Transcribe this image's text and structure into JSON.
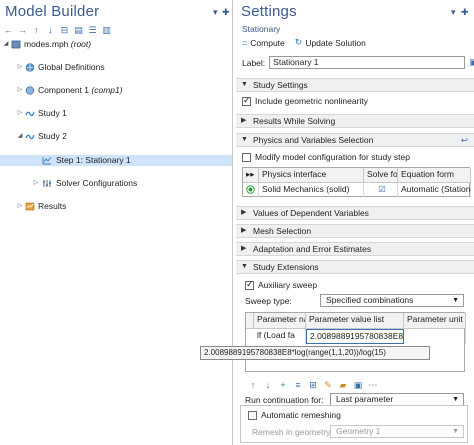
{
  "model_builder": {
    "title": "Model Builder",
    "pin_icon": "pin-icon",
    "toolbar": [
      "back-arrow-icon",
      "forward-arrow-icon",
      "up-arrow-icon",
      "down-arrow-icon",
      "collapse-icon",
      "expand-icon",
      "view-options-icon",
      "more-icon"
    ],
    "tree": [
      {
        "label": "modes.mph",
        "suffix": "(root)",
        "icon": "model-file-icon",
        "level": 0,
        "expanded": true
      },
      {
        "label": "Global Definitions",
        "suffix": "",
        "icon": "globe-icon",
        "level": 1,
        "expanded": false
      },
      {
        "label": "Component 1",
        "suffix": "(comp1)",
        "icon": "component-icon",
        "level": 1,
        "expanded": false
      },
      {
        "label": "Study 1",
        "suffix": "",
        "icon": "study-icon",
        "level": 1,
        "expanded": false
      },
      {
        "label": "Study 2",
        "suffix": "",
        "icon": "study-icon",
        "level": 1,
        "expanded": true
      },
      {
        "label": "Step 1: Stationary 1",
        "suffix": "",
        "icon": "stationary-step-icon",
        "level": 2,
        "selected": true
      },
      {
        "label": "Solver Configurations",
        "suffix": "",
        "icon": "solver-icon",
        "level": 2,
        "expanded": false
      },
      {
        "label": "Results",
        "suffix": "",
        "icon": "results-icon",
        "level": 1,
        "expanded": false
      }
    ]
  },
  "settings": {
    "title": "Settings",
    "subtitle": "Stationary",
    "compute_label": "Compute",
    "update_label": "Update Solution",
    "label_caption": "Label:",
    "label_value": "Stationary 1",
    "sections": {
      "study_settings": "Study Settings",
      "include_geom": "Include geometric nonlinearity",
      "results_while_solving": "Results While Solving",
      "physics_selection": "Physics and Variables Selection",
      "modify_config": "Modify model configuration for study step",
      "values_dependent": "Values of Dependent Variables",
      "mesh_selection": "Mesh Selection",
      "adaptation": "Adaptation and Error Estimates",
      "study_extensions": "Study Extensions"
    },
    "physics_table": {
      "headers": [
        "Physics interface",
        "Solve for",
        "Equation form"
      ],
      "rows": [
        {
          "interface": "Solid Mechanics (solid)",
          "solve_for": true,
          "equation_form": "Automatic (Station..."
        }
      ]
    },
    "aux_sweep": {
      "label": "Auxiliary sweep",
      "checked": true,
      "sweep_type_label": "Sweep type:",
      "sweep_type_value": "Specified combinations",
      "table_headers": [
        "Parameter na",
        "Parameter value list",
        "Parameter unit"
      ],
      "table_row": {
        "name": "lf (Load fa",
        "value": "2.0089889195780838E8*lo...",
        "unit": ""
      },
      "tooltip": "2.0089889195780838E8*log(range(1,1,20))/log(15)",
      "run_continuation_label": "Run continuation for:",
      "run_continuation_value": "Last parameter",
      "auto_remesh_label": "Automatic remeshing",
      "remesh_geom_label": "Remesh in geometry:",
      "remesh_geom_value": "Geometry 1"
    }
  },
  "colors": {
    "title_blue": "#3b5c8c",
    "selection": "#cfe3fb",
    "section_bg": "#eef0f2",
    "icon_blue": "#3a6fb0",
    "radio_green": "#2e9a3a"
  }
}
